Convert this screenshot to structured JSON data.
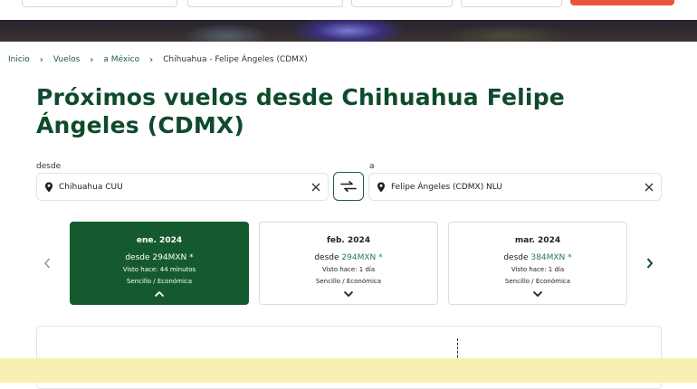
{
  "breadcrumb": {
    "items": [
      "Inicio",
      "Vuelos",
      "a México"
    ],
    "current": "Chihuahua - Felipe Ángeles (CDMX)"
  },
  "title": "Próximos vuelos desde Chihuahua Felipe Ángeles (CDMX)",
  "search": {
    "from_label": "desde",
    "from_value": "Chihuahua CUU",
    "to_label": "a",
    "to_value": "Felipe Ángeles (CDMX) NLU"
  },
  "months": [
    {
      "month": "ene. 2024",
      "price_prefix": "desde",
      "price": "294MXN",
      "asterisk": "*",
      "seen": "Visto hace: 44 minutos",
      "trip": "Sencillo / Económica",
      "active": true
    },
    {
      "month": "feb. 2024",
      "price_prefix": "desde",
      "price": "294MXN",
      "asterisk": "*",
      "seen": "Visto hace: 1 día",
      "trip": "Sencillo / Económica",
      "active": false
    },
    {
      "month": "mar. 2024",
      "price_prefix": "desde",
      "price": "384MXN",
      "asterisk": "*",
      "seen": "Visto hace: 1 día",
      "trip": "Sencillo / Económica",
      "active": false
    }
  ],
  "colors": {
    "brand_green": "#155a2f",
    "title_green": "#0f4a2c",
    "price_green": "#2b7a4b",
    "banner": "#f7f0b2"
  }
}
